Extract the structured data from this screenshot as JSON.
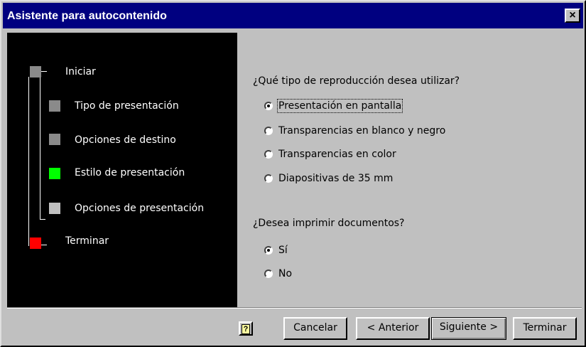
{
  "window": {
    "title": "Asistente para autocontenido",
    "close_glyph": "×",
    "close_icon": "close-icon"
  },
  "steps": [
    {
      "label": "Iniciar",
      "color": "#8a8a8a"
    },
    {
      "label": "Tipo de presentación",
      "color": "#8a8a8a"
    },
    {
      "label": "Opciones de destino",
      "color": "#8a8a8a"
    },
    {
      "label": "Estilo de presentación",
      "color": "#00ff00",
      "current": true
    },
    {
      "label": "Opciones de presentación",
      "color": "#c0c0c0"
    },
    {
      "label": "Terminar",
      "color": "#ff0000"
    }
  ],
  "content": {
    "question1": "¿Qué tipo de reproducción desea utilizar?",
    "output_options": [
      {
        "label": "Presentación en pantalla",
        "selected": true
      },
      {
        "label": "Transparencias en blanco y negro",
        "selected": false
      },
      {
        "label": "Transparencias en color",
        "selected": false
      },
      {
        "label": "Diapositivas de 35 mm",
        "selected": false
      }
    ],
    "question2": "¿Desea imprimir documentos?",
    "print_options": [
      {
        "label": "Sí",
        "selected": true
      },
      {
        "label": "No",
        "selected": false
      }
    ]
  },
  "buttons": {
    "help_glyph": "?",
    "help_icon": "help-icon",
    "cancel": "Cancelar",
    "back": "< Anterior",
    "next": "Siguiente >",
    "finish": "Terminar"
  },
  "colors": {
    "titlebar": "#000080",
    "panel": "#000000",
    "face": "#c0c0c0"
  }
}
